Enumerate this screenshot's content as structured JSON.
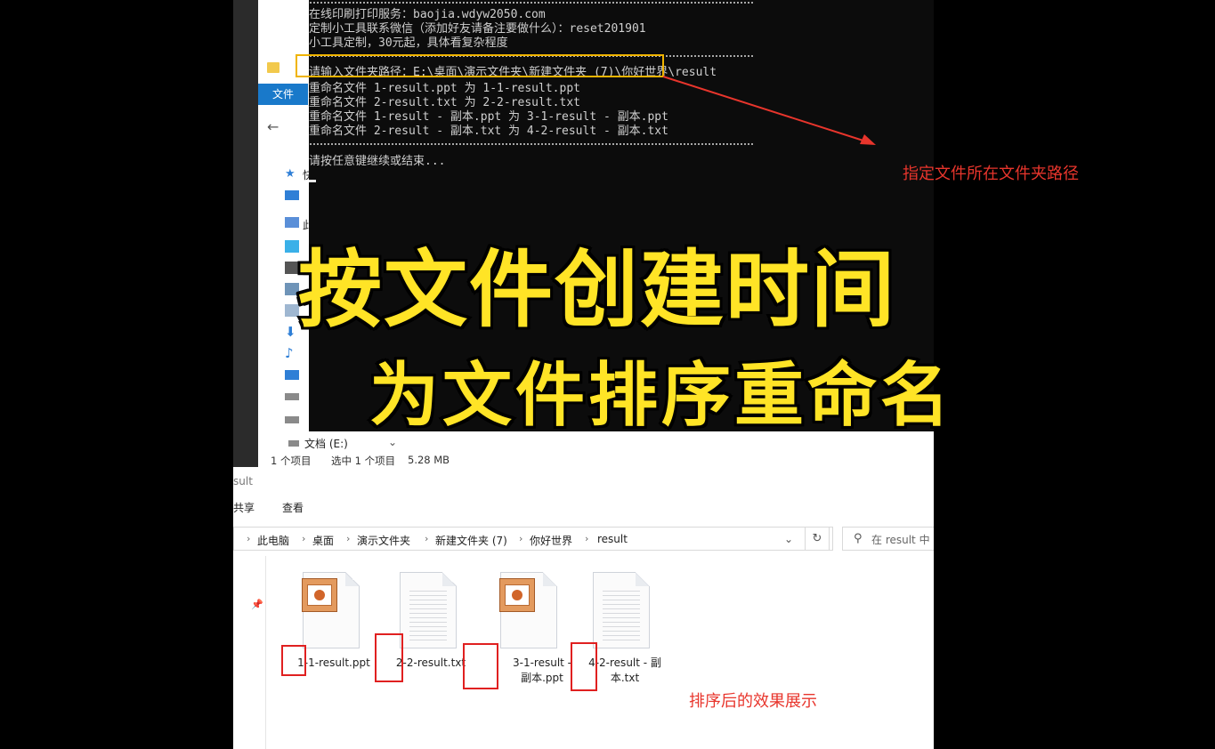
{
  "back_explorer": {
    "ribbon_file_tab": "文件",
    "tree_items": [
      "快",
      "此"
    ],
    "drive_label": "文档 (E:)",
    "status": {
      "item_count": "1 个项目",
      "selected": "选中 1 个项目",
      "size": "5.28 MB"
    }
  },
  "console": {
    "lines": [
      "在线印刷打印服务：baojia.wdyw2050.com",
      "定制小工具联系微信（添加好友请备注要做什么）：reset201901",
      "小工具定制，30元起，具体看复杂程度",
      "请输入文件夹路径：E:\\桌面\\演示文件夹\\新建文件夹 (7)\\你好世界\\result",
      "重命名文件 1-result.ppt 为 1-1-result.ppt",
      "重命名文件 2-result.txt 为 2-2-result.txt",
      "重命名文件 1-result - 副本.ppt 为 3-1-result - 副本.ppt",
      "重命名文件 2-result - 副本.txt 为 4-2-result - 副本.txt",
      "请按任意键继续或结束..."
    ]
  },
  "annotations": {
    "folder_path_note": "指定文件所在文件夹路径",
    "result_note": "排序后的效果展示"
  },
  "overlay_titles": {
    "line1": "按文件创建时间",
    "line2": "为文件排序重命名"
  },
  "front_explorer": {
    "window_title": "sult",
    "menu": {
      "share": "共享",
      "view": "查看"
    },
    "breadcrumbs": [
      "此电脑",
      "桌面",
      "演示文件夹",
      "新建文件夹 (7)",
      "你好世界",
      "result"
    ],
    "search_placeholder": "在 result 中",
    "files": [
      {
        "name": "1-1-result.ppt",
        "type": "ppt"
      },
      {
        "name": "2-2-result.txt",
        "type": "txt"
      },
      {
        "name": "3-1-result - 副本.ppt",
        "type": "ppt"
      },
      {
        "name": "4-2-result - 副本.txt",
        "type": "txt"
      }
    ]
  },
  "colors": {
    "title_yellow": "#ffe426",
    "highlight_orange": "#f0b400",
    "annotation_red": "#e8352c",
    "console_bg": "#0c0c0c",
    "explorer_accent": "#1979ca"
  }
}
